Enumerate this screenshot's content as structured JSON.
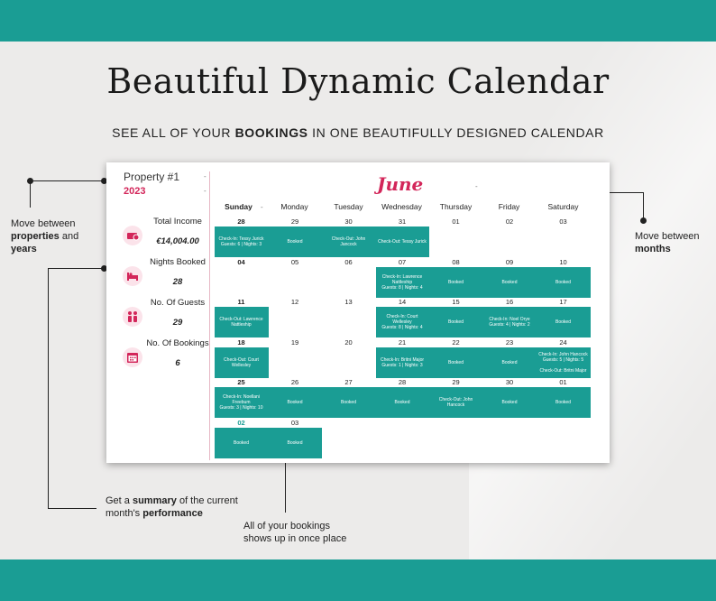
{
  "hero": {
    "title": "Beautiful Dynamic Calendar",
    "subtitle_1": "SEE ALL  OF YOUR ",
    "subtitle_bold": "BOOKINGS",
    "subtitle_2": " IN ONE BEAUTIFULLY DESIGNED CALENDAR"
  },
  "callouts": {
    "left_a_1": "Move between",
    "left_a_2": "properties",
    "left_a_3": "and",
    "left_a_4": "years",
    "right_1": "Move between",
    "right_2": "months",
    "summary_1": "Get a ",
    "summary_2": "summary",
    "summary_3": " of the current",
    "summary_4": "month's ",
    "summary_5": "performance",
    "bottom_1": "All of your bookings",
    "bottom_2": "shows up in once place"
  },
  "calendar": {
    "property": "Property #1",
    "year": "2023",
    "month": "June",
    "month_dash": "-",
    "stats": [
      {
        "label": "Total Income",
        "value": "€14,004.00",
        "icon": "money-icon"
      },
      {
        "label": "Nights Booked",
        "value": "28",
        "icon": "bed-icon"
      },
      {
        "label": "No. Of Guests",
        "value": "29",
        "icon": "guests-icon"
      },
      {
        "label": "No. Of Bookings",
        "value": "6",
        "icon": "calendar-icon"
      }
    ],
    "weekdays": [
      "Sunday",
      "Monday",
      "Tuesday",
      "Wednesday",
      "Thursday",
      "Friday",
      "Saturday"
    ],
    "weeks": [
      {
        "days": [
          "28",
          "29",
          "30",
          "31",
          "01",
          "02",
          "03"
        ],
        "events": [
          "Check-In: Tessy Jurick\nGuests: 6 | Nights: 3",
          "Booked",
          "Check-Out: John\nJancock",
          "Check-Out: Tessy Jurick",
          "",
          "",
          ""
        ]
      },
      {
        "days": [
          "04",
          "05",
          "06",
          "07",
          "08",
          "09",
          "10"
        ],
        "events": [
          "",
          "",
          "",
          "Check-In: Lawrence\nNattleship\nGuests: 8 | Nights: 4",
          "Booked",
          "Booked",
          "Booked"
        ]
      },
      {
        "days": [
          "11",
          "12",
          "13",
          "14",
          "15",
          "16",
          "17"
        ],
        "events": [
          "Check-Out: Lawrence\nNattleship",
          "",
          "",
          "Check-In: Court\nWellesley\nGuests: 8 | Nights: 4",
          "Booked",
          "Check-In: Noel Orye\nGuests: 4 | Nights: 2",
          "Booked"
        ]
      },
      {
        "days": [
          "18",
          "19",
          "20",
          "21",
          "22",
          "23",
          "24"
        ],
        "events": [
          "Check-Out: Court\nWellesley",
          "",
          "",
          "Check-In: Britni Major\nGuests: 1 | Nights: 3",
          "Booked",
          "Booked",
          "Check-In: John Hancock\nGuests: 5 | Nights: 5\n\nCheck-Out: Britni Major"
        ]
      },
      {
        "days": [
          "25",
          "26",
          "27",
          "28",
          "29",
          "30",
          "01"
        ],
        "events": [
          "Check-In: Noellani\nFreebum\nGuests: 3 | Nights: 10",
          "Booked",
          "Booked",
          "Booked",
          "Check-Out: John\nHancock",
          "Booked",
          "Booked"
        ]
      },
      {
        "days": [
          "02",
          "03",
          "",
          "",
          "",
          "",
          ""
        ],
        "events": [
          "Booked",
          "Booked",
          "",
          "",
          "",
          "",
          ""
        ]
      }
    ]
  },
  "colors": {
    "teal": "#1a9d94",
    "accent": "#d3265a"
  }
}
